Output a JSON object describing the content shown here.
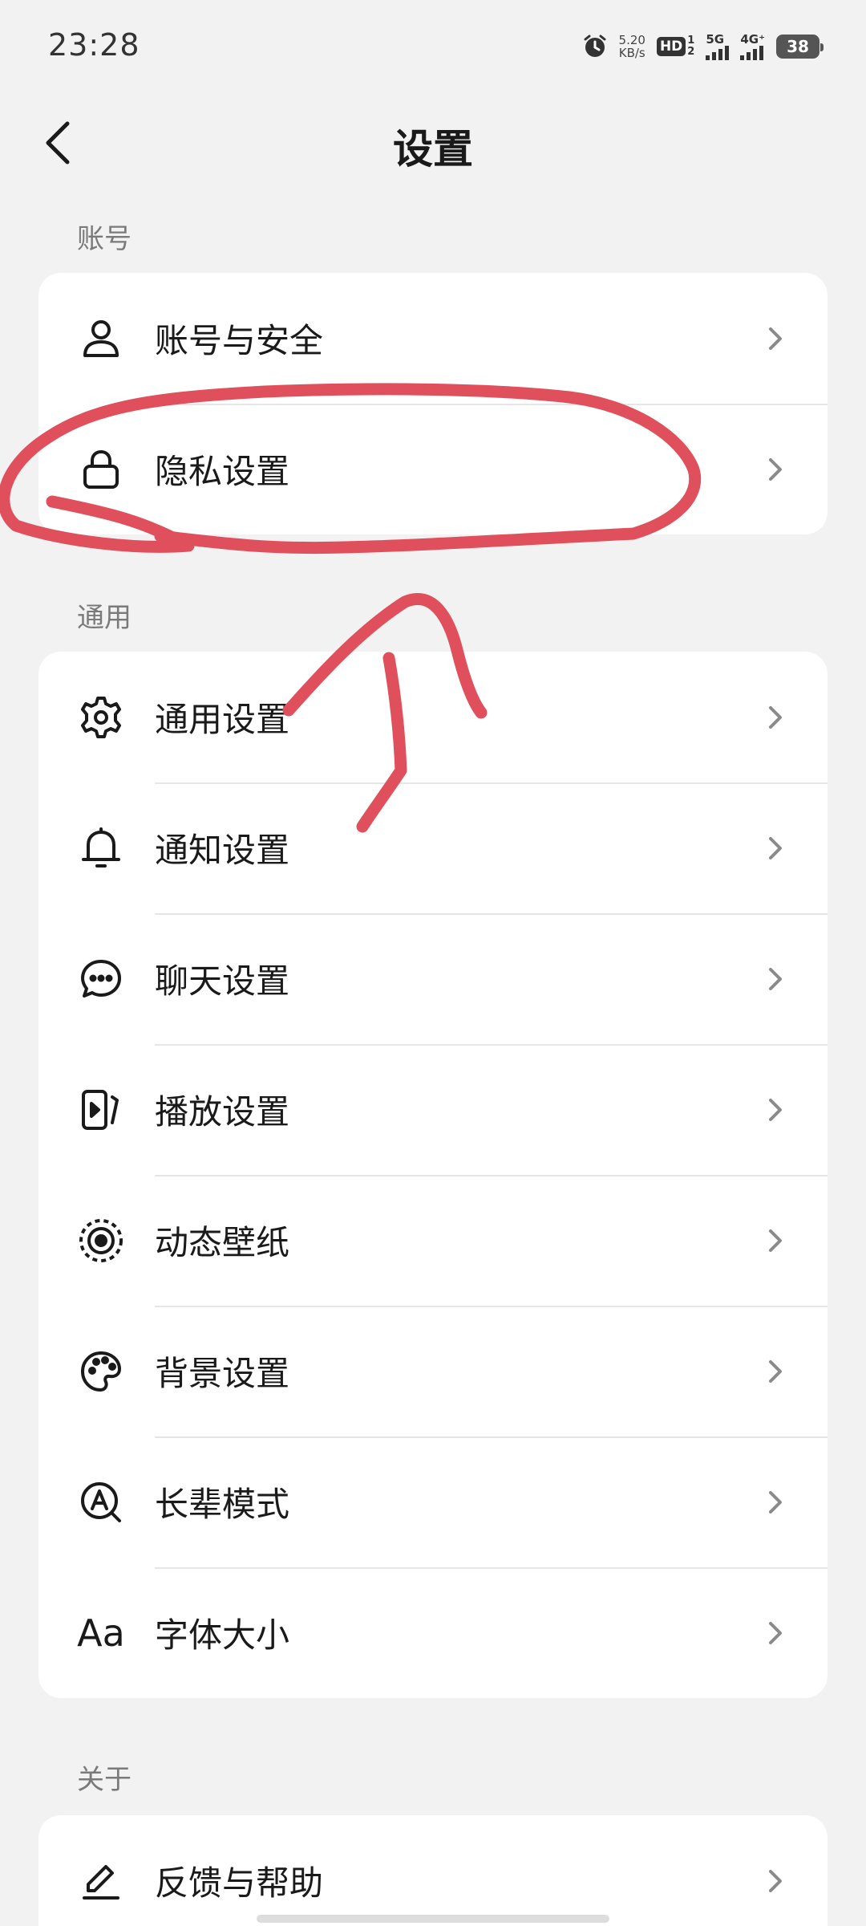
{
  "status_bar": {
    "time": "23:28",
    "net_speed_value": "5.20",
    "net_speed_unit": "KB/s",
    "hd_label": "HD",
    "hd_sim_top": "1",
    "hd_sim_bottom": "2",
    "signal_1_label": "5G",
    "signal_2_label": "4G⁺",
    "battery_level": "38"
  },
  "header": {
    "title": "设置"
  },
  "sections": {
    "account": {
      "label": "账号",
      "items": [
        {
          "label": "账号与安全",
          "icon": "person-icon"
        },
        {
          "label": "隐私设置",
          "icon": "lock-icon"
        }
      ]
    },
    "general": {
      "label": "通用",
      "items": [
        {
          "label": "通用设置",
          "icon": "gear-icon"
        },
        {
          "label": "通知设置",
          "icon": "bell-icon"
        },
        {
          "label": "聊天设置",
          "icon": "chat-bubble-icon"
        },
        {
          "label": "播放设置",
          "icon": "play-screen-icon"
        },
        {
          "label": "动态壁纸",
          "icon": "dynamic-wallpaper-icon"
        },
        {
          "label": "背景设置",
          "icon": "palette-icon"
        },
        {
          "label": "长辈模式",
          "icon": "elder-mode-icon"
        },
        {
          "label": "字体大小",
          "icon": "font-size-icon",
          "icon_text": "Aa"
        }
      ]
    },
    "about": {
      "label": "关于",
      "items": [
        {
          "label": "反馈与帮助",
          "icon": "pen-icon"
        }
      ]
    }
  },
  "colors": {
    "background": "#f2f2f2",
    "card": "#ffffff",
    "annotation": "#e0505c",
    "section_label": "#7a7a7a"
  }
}
